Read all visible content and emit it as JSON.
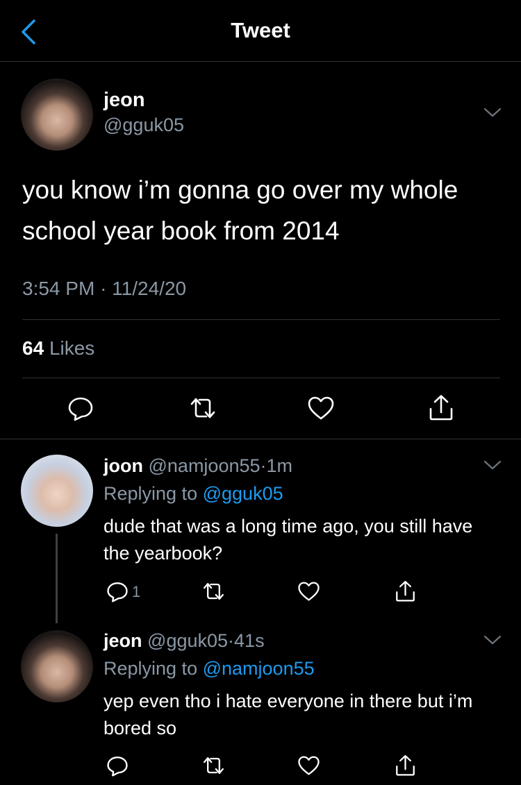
{
  "header": {
    "title": "Tweet",
    "back_icon": "chevron-left-icon",
    "accent_color": "#1d9bf0"
  },
  "main_tweet": {
    "name": "jeon",
    "handle": "@gguk05",
    "text": "you know i’m gonna go over my whole school year book from 2014",
    "time": "3:54 PM",
    "separator": "·",
    "date": "11/24/20",
    "likes_count": "64",
    "likes_label": "Likes"
  },
  "replies": [
    {
      "name": "joon",
      "handle": "@namjoon55",
      "separator": "·",
      "time": "1m",
      "replying_prefix": "Replying to",
      "replying_to": "@gguk05",
      "text": "dude that was a long time ago, you still have the yearbook?",
      "reply_count": "1"
    },
    {
      "name": "jeon",
      "handle": "@gguk05",
      "separator": "·",
      "time": "41s",
      "replying_prefix": "Replying to",
      "replying_to": "@namjoon55",
      "text": "yep even tho i hate everyone in there but i’m bored so"
    }
  ],
  "colors": {
    "background": "#000000",
    "text_primary": "#ffffff",
    "text_secondary": "#8b98a5",
    "divider": "#2f3336",
    "link": "#1d9bf0"
  }
}
